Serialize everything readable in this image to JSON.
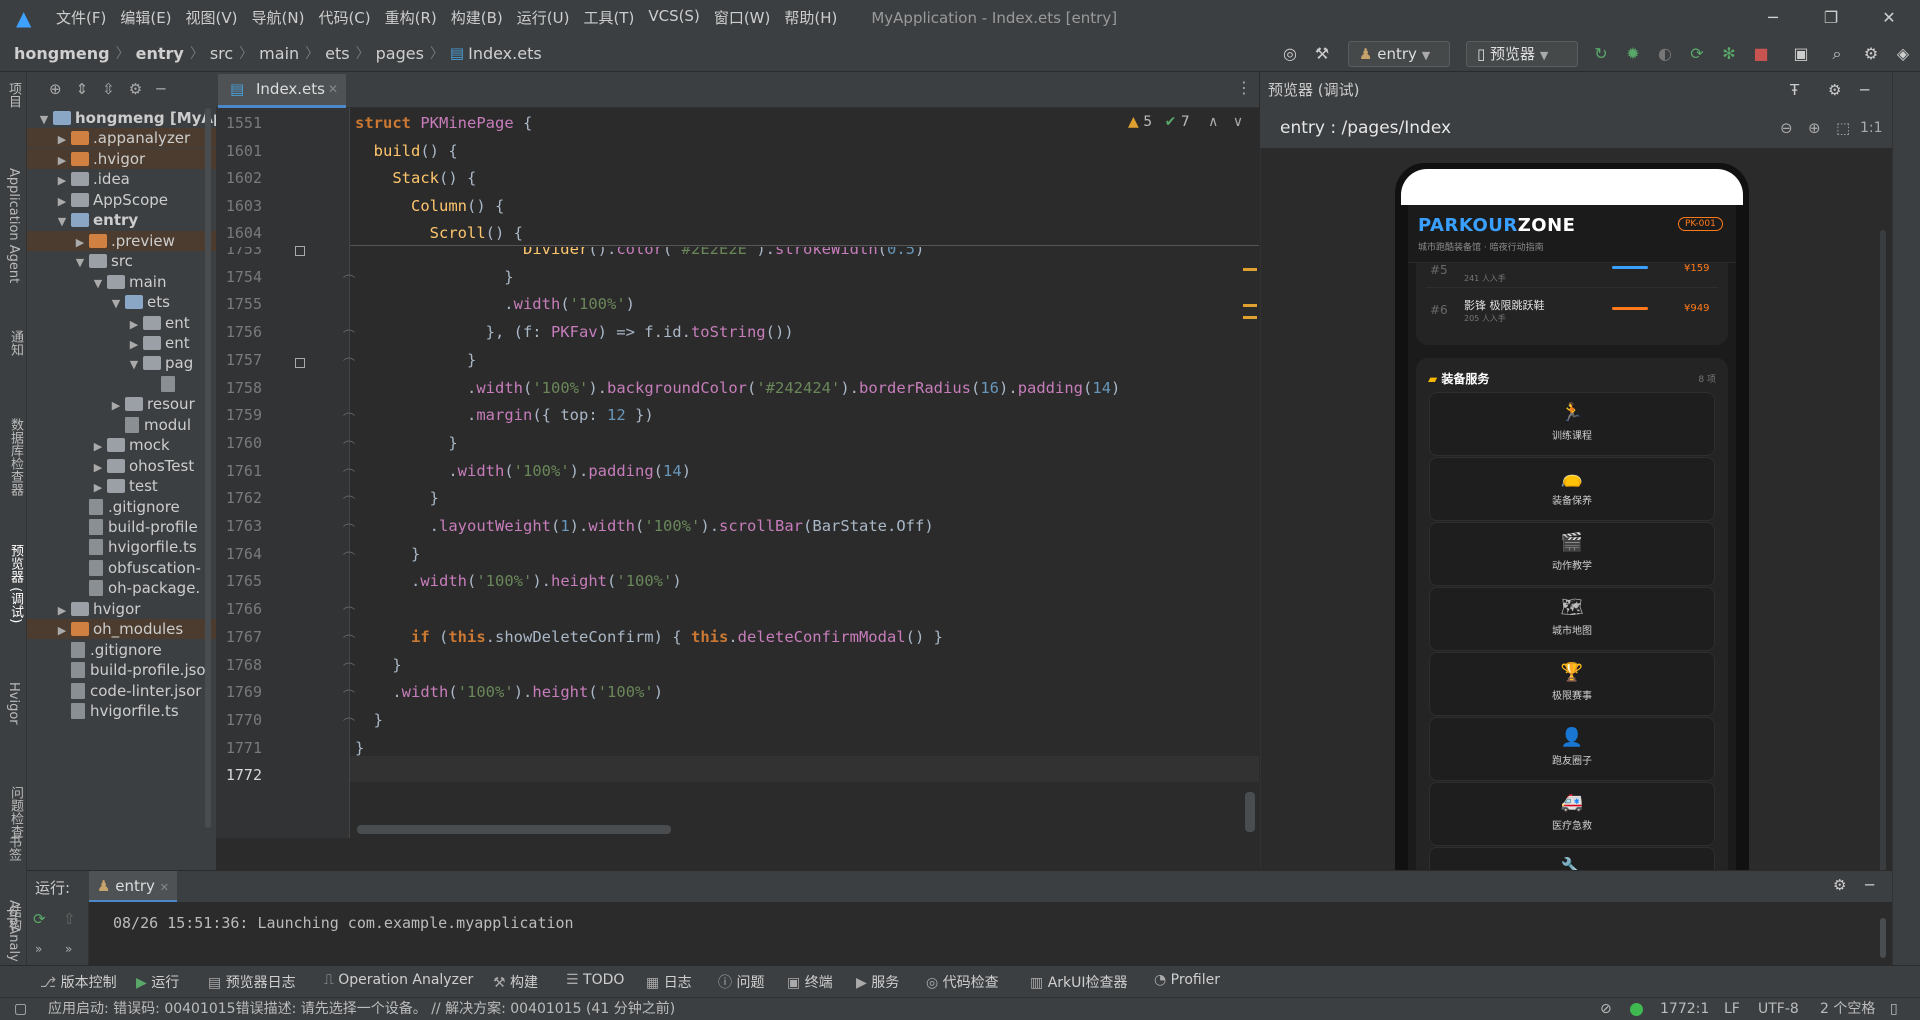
{
  "menu": {
    "items": [
      "文件(F)",
      "编辑(E)",
      "视图(V)",
      "导航(N)",
      "代码(C)",
      "重构(R)",
      "构建(B)",
      "运行(U)",
      "工具(T)",
      "VCS(S)",
      "窗口(W)",
      "帮助(H)"
    ],
    "window_title": "MyApplication - Index.ets [entry]"
  },
  "breadcrumb": [
    "hongmeng",
    "entry",
    "src",
    "main",
    "ets",
    "pages",
    "Index.ets"
  ],
  "toolbar": {
    "run_config": "entry",
    "previewer": "预览器"
  },
  "left_strip": {
    "project": "项目",
    "bookmarks": "书签",
    "structure": "结构"
  },
  "project_tree": [
    {
      "label": "hongmeng [MyAp",
      "indent": 0,
      "exp": "v",
      "icon": "b",
      "bold": true
    },
    {
      "label": ".appanalyzer",
      "indent": 1,
      "exp": ">",
      "icon": "o",
      "hl": true
    },
    {
      "label": ".hvigor",
      "indent": 1,
      "exp": ">",
      "icon": "o",
      "hl": true
    },
    {
      "label": ".idea",
      "indent": 1,
      "exp": ">",
      "icon": "g"
    },
    {
      "label": "AppScope",
      "indent": 1,
      "exp": ">",
      "icon": "g"
    },
    {
      "label": "entry",
      "indent": 1,
      "exp": "v",
      "icon": "b",
      "bold": true
    },
    {
      "label": ".preview",
      "indent": 2,
      "exp": ">",
      "icon": "o",
      "hl": true
    },
    {
      "label": "src",
      "indent": 2,
      "exp": "v",
      "icon": "g"
    },
    {
      "label": "main",
      "indent": 3,
      "exp": "v",
      "icon": "g"
    },
    {
      "label": "ets",
      "indent": 4,
      "exp": "v",
      "icon": "b"
    },
    {
      "label": "ent",
      "indent": 5,
      "exp": ">",
      "icon": "g"
    },
    {
      "label": "ent",
      "indent": 5,
      "exp": ">",
      "icon": "g"
    },
    {
      "label": "pag",
      "indent": 5,
      "exp": "v",
      "icon": "g"
    },
    {
      "label": "",
      "indent": 6,
      "exp": "",
      "icon": "f"
    },
    {
      "label": "resour",
      "indent": 4,
      "exp": ">",
      "icon": "g"
    },
    {
      "label": "modul",
      "indent": 4,
      "exp": "",
      "icon": "f"
    },
    {
      "label": "mock",
      "indent": 3,
      "exp": ">",
      "icon": "g"
    },
    {
      "label": "ohosTest",
      "indent": 3,
      "exp": ">",
      "icon": "g"
    },
    {
      "label": "test",
      "indent": 3,
      "exp": ">",
      "icon": "g"
    },
    {
      "label": ".gitignore",
      "indent": 2,
      "exp": "",
      "icon": "f"
    },
    {
      "label": "build-profile",
      "indent": 2,
      "exp": "",
      "icon": "f"
    },
    {
      "label": "hvigorfile.ts",
      "indent": 2,
      "exp": "",
      "icon": "f"
    },
    {
      "label": "obfuscation-",
      "indent": 2,
      "exp": "",
      "icon": "f"
    },
    {
      "label": "oh-package.",
      "indent": 2,
      "exp": "",
      "icon": "f"
    },
    {
      "label": "hvigor",
      "indent": 1,
      "exp": ">",
      "icon": "g"
    },
    {
      "label": "oh_modules",
      "indent": 1,
      "exp": ">",
      "icon": "o",
      "hl": true
    },
    {
      "label": ".gitignore",
      "indent": 1,
      "exp": "",
      "icon": "f"
    },
    {
      "label": "build-profile.jso",
      "indent": 1,
      "exp": "",
      "icon": "f"
    },
    {
      "label": "code-linter.jsor",
      "indent": 1,
      "exp": "",
      "icon": "f"
    },
    {
      "label": "hvigorfile.ts",
      "indent": 1,
      "exp": "",
      "icon": "f"
    }
  ],
  "editor": {
    "tab": "Index.ets",
    "warnings": "5",
    "weak_warnings": "7",
    "sticky": [
      {
        "ln": "1551",
        "html": "<span class='kw'>struct</span> <span class='typ'>PKMinePage</span> {"
      },
      {
        "ln": "1601",
        "html": "  <span class='fn'>build</span>() {"
      },
      {
        "ln": "1602",
        "html": "    <span class='fn'>Stack</span>() {"
      },
      {
        "ln": "1603",
        "html": "      <span class='fn'>Column</span>() {"
      },
      {
        "ln": "1604",
        "html": "        <span class='fn'>Scroll</span>() {"
      }
    ],
    "lines": [
      {
        "ln": "1753",
        "html": "                  <span class='fn'>Divider</span>().<span class='mth'>color</span>(<span class='str'>'#2E2E2E'</span>).<span class='mth'>strokeWidth</span>(<span class='num'>0.5</span>)"
      },
      {
        "ln": "1754",
        "html": "                }"
      },
      {
        "ln": "1755",
        "html": "                .<span class='mth'>width</span>(<span class='str'>'100%'</span>)"
      },
      {
        "ln": "1756",
        "html": "              }, (f: <span class='typ'>PKFav</span>) => f.id.<span class='mth'>toString</span>())"
      },
      {
        "ln": "1757",
        "html": "            }"
      },
      {
        "ln": "1758",
        "html": "            .<span class='mth'>width</span>(<span class='str'>'100%'</span>).<span class='mth'>backgroundColor</span>(<span class='str'>'#242424'</span>).<span class='mth'>borderRadius</span>(<span class='num'>16</span>).<span class='mth'>padding</span>(<span class='num'>14</span>)"
      },
      {
        "ln": "1759",
        "html": "            .<span class='mth'>margin</span>({ top: <span class='num'>12</span> })"
      },
      {
        "ln": "1760",
        "html": "          }"
      },
      {
        "ln": "1761",
        "html": "          .<span class='mth'>width</span>(<span class='str'>'100%'</span>).<span class='mth'>padding</span>(<span class='num'>14</span>)"
      },
      {
        "ln": "1762",
        "html": "        }"
      },
      {
        "ln": "1763",
        "html": "        .<span class='mth'>layoutWeight</span>(<span class='num'>1</span>).<span class='mth'>width</span>(<span class='str'>'100%'</span>).<span class='mth'>scrollBar</span>(BarState.Off)"
      },
      {
        "ln": "1764",
        "html": "      }"
      },
      {
        "ln": "1765",
        "html": "      .<span class='mth'>width</span>(<span class='str'>'100%'</span>).<span class='mth'>height</span>(<span class='str'>'100%'</span>)"
      },
      {
        "ln": "1766",
        "html": ""
      },
      {
        "ln": "1767",
        "html": "      <span class='kw'>if</span> (<span class='kw'>this</span>.showDeleteConfirm) { <span class='kw'>this</span>.<span class='mth'>deleteConfirmModal</span>() }"
      },
      {
        "ln": "1768",
        "html": "    }"
      },
      {
        "ln": "1769",
        "html": "    .<span class='mth'>width</span>(<span class='str'>'100%'</span>).<span class='mth'>height</span>(<span class='str'>'100%'</span>)"
      },
      {
        "ln": "1770",
        "html": "  }"
      },
      {
        "ln": "1771",
        "html": "}"
      },
      {
        "ln": "1772",
        "html": ""
      }
    ]
  },
  "preview": {
    "title": "预览器 (调试)",
    "route": "entry : /pages/Index",
    "zoom_label": "1:1",
    "app": {
      "brand_a": "PARKOUR",
      "brand_b": "ZONE",
      "subtitle": "城市跑酷装备馆 · 暗夜行动指南",
      "badge": "PK-001",
      "rank5": {
        "rank": "#5",
        "name": "",
        "sub": "241 人入手",
        "price": "¥159"
      },
      "rank6": {
        "rank": "#6",
        "name": "影锋 极限跳跃鞋",
        "sub": "205 人入手",
        "price": "¥949"
      },
      "services_title": "装备服务",
      "services_count": "8 项",
      "services": [
        {
          "icon": "🏃",
          "label": "训练课程"
        },
        {
          "icon": "👝",
          "label": "装备保养"
        },
        {
          "icon": "🎬",
          "label": "动作教学"
        },
        {
          "icon": "🗺",
          "label": "城市地图"
        },
        {
          "icon": "🏆",
          "label": "极限赛事"
        },
        {
          "icon": "👤",
          "label": "跑友圈子"
        },
        {
          "icon": "🚑",
          "label": "医疗急救"
        },
        {
          "icon": "🔧",
          "label": ""
        }
      ]
    }
  },
  "right_strip": [
    "Application Agent",
    "通知",
    "数据库检查器",
    "预览器 (调试)",
    "Hvigor",
    "问题检查",
    "AppAnaly"
  ],
  "run": {
    "label": "运行:",
    "tab": "entry",
    "log": "08/26 15:51:36: Launching com.example.myapplication"
  },
  "tool_windows": [
    "版本控制",
    "运行",
    "预览器日志",
    "Operation Analyzer",
    "构建",
    "TODO",
    "日志",
    "问题",
    "终端",
    "服务",
    "代码检查",
    "ArkUI检查器",
    "Profiler"
  ],
  "status": {
    "message": "应用启动: 错误码: 00401015错误描述: 请先选择一个设备。 // 解决方案: 00401015 (41 分钟之前)",
    "position": "1772:1",
    "line_sep": "LF",
    "encoding": "UTF-8",
    "indent": "2 个空格"
  },
  "colors": {
    "accent": "#4a88c7",
    "brand_blue": "#3aa0ff",
    "brand_orange": "#ff7a1a",
    "warning": "#e0a030"
  }
}
